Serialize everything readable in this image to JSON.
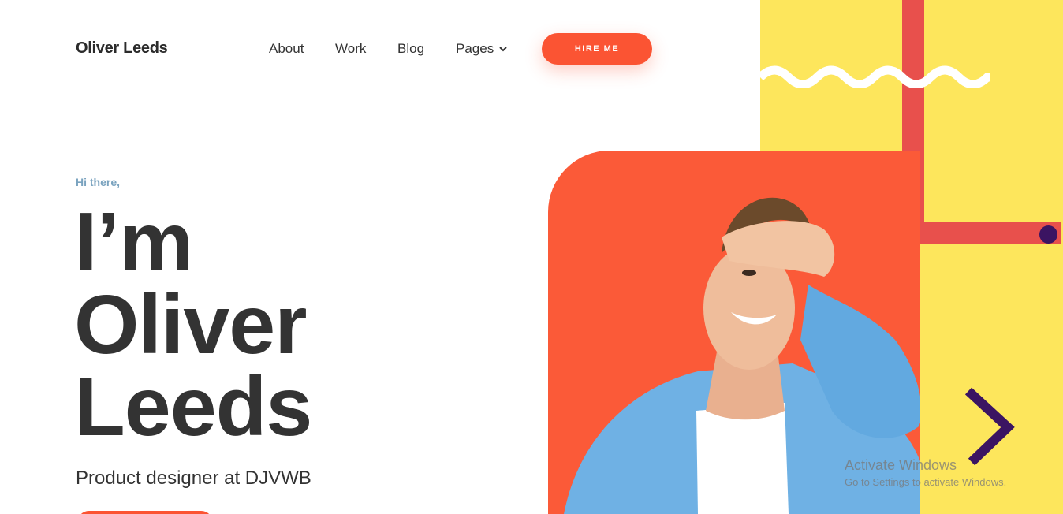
{
  "header": {
    "logo": "Oliver Leeds",
    "nav": {
      "about": "About",
      "work": "Work",
      "blog": "Blog",
      "pages": "Pages"
    },
    "hire_button": "HIRE ME"
  },
  "hero": {
    "greeting": "Hi there,",
    "line1": "I’m",
    "line2": "Oliver",
    "line3": "Leeds",
    "subtitle": "Product designer at DJVWB"
  },
  "watermark": {
    "title": "Activate Windows",
    "subtitle": "Go to Settings to activate Windows."
  },
  "colors": {
    "accent": "#fb5433",
    "yellow": "#fde65c",
    "red": "#e8504c",
    "purple": "#3b1462",
    "greeting": "#7aa3bf"
  },
  "icons": {
    "pages_dropdown": "chevron-down-icon"
  }
}
